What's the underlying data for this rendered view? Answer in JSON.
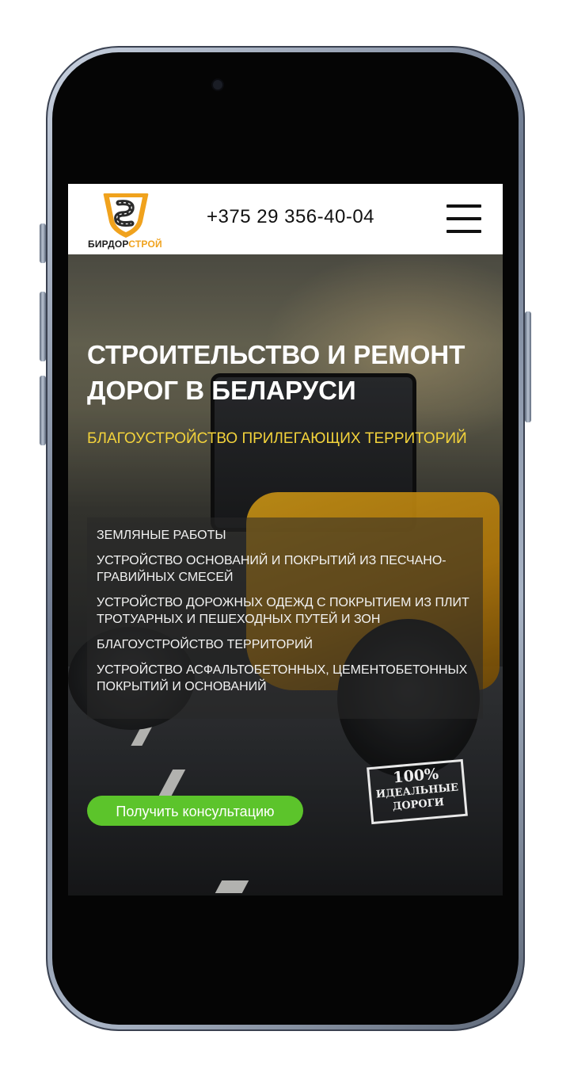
{
  "header": {
    "logo_text_part1": "БИРДОР",
    "logo_text_part2": "СТРОЙ",
    "phone": "+375 29 356-40-04"
  },
  "hero": {
    "title": "СТРОИТЕЛЬСТВО И РЕМОНТ ДОРОГ В БЕЛАРУСИ",
    "subtitle": "БЛАГОУСТРОЙСТВО ПРИЛЕГАЮЩИХ ТЕРРИТОРИЙ",
    "services": [
      "ЗЕМЛЯНЫЕ РАБОТЫ",
      "УСТРОЙСТВО ОСНОВАНИЙ И ПОКРЫТИЙ ИЗ ПЕСЧАНО-ГРАВИЙНЫХ СМЕСЕЙ",
      "УСТРОЙСТВО ДОРОЖНЫХ ОДЕЖД С ПОКРЫТИЕМ ИЗ ПЛИТ ТРОТУАРНЫХ И ПЕШЕХОДНЫХ ПУТЕЙ И ЗОН",
      "БЛАГОУСТРОЙСТВО ТЕРРИТОРИЙ",
      "УСТРОЙСТВО АСФАЛЬТОБЕТОННЫХ, ЦЕМЕНТОБЕТОННЫХ ПОКРЫТИЙ И ОСНОВАНИЙ"
    ],
    "cta_label": "Получить консультацию",
    "stamp_line1": "100%",
    "stamp_line2": "ИДЕАЛЬНЫЕ",
    "stamp_line3": "ДОРОГИ"
  },
  "colors": {
    "accent_yellow": "#f3d33b",
    "logo_orange": "#f0a21d",
    "cta_green": "#5cc42b"
  },
  "icons": [
    "road-logo-icon",
    "hamburger-menu-icon"
  ]
}
